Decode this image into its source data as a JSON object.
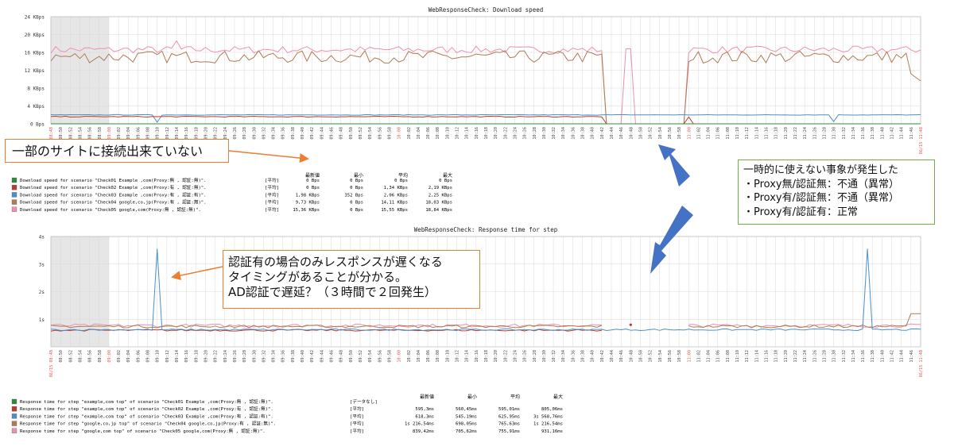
{
  "chart_data": [
    {
      "type": "line",
      "title": "WebResponseCheck: Download speed",
      "y_tick_labels": [
        "0 Bps",
        "4 KBps",
        "8 KBps",
        "12 KBps",
        "16 KBps",
        "20 KBps",
        "24 KBps"
      ],
      "ylim": [
        0,
        24
      ],
      "unit": "KBps",
      "time_range": [
        "08:48",
        "11:48"
      ],
      "gray_span": [
        "08:48",
        "09:00"
      ],
      "series": [
        {
          "name": "Download speed for scenario \"Check01 Example ,com(Proxy:無 , 認証:無)\".",
          "color": "#2e8b3e",
          "stats": {
            "agg": "[平均]",
            "last": "0 Bps",
            "min": "0 Bps",
            "avg": "0 Bps",
            "max": "0 Bps"
          }
        },
        {
          "name": "Download speed for scenario \"Check02 Example ,com(Proxy:有 , 認証:無)\".",
          "color": "#c0392b",
          "stats": {
            "agg": "[平均]",
            "last": "0 Bps",
            "min": "0 Bps",
            "avg": "1,34 KBps",
            "max": "2,19 KBps"
          }
        },
        {
          "name": "Download speed for scenario \"Check03 Example ,com(Proxy:有 , 認証:有)\".",
          "color": "#4a90c8",
          "stats": {
            "agg": "[平均]",
            "last": "1,98 KBps",
            "min": "352 Bps",
            "avg": "2,06 KBps",
            "max": "2,25 KBps"
          }
        },
        {
          "name": "Download speed for scenario \"Check04 google,co,jp(Proxy:有 , 認証:無)\".",
          "color": "#b07a55",
          "stats": {
            "agg": "[平均]",
            "last": "9,73 KBps",
            "min": "0 Bps",
            "avg": "14,11 KBps",
            "max": "18,03 KBps"
          }
        },
        {
          "name": "Download speed for scenario \"Check05 google,com(Proxy:無 , 認証:無)\".",
          "color": "#ee8fb0",
          "stats": {
            "agg": "[平均]",
            "last": "15,36 KBps",
            "min": "0 Bps",
            "avg": "15,55 KBps",
            "max": "18,84 KBps"
          }
        }
      ]
    },
    {
      "type": "line",
      "title": "WebResponseCheck: Response time for step",
      "y_tick_labels": [
        "1s",
        "2s",
        "3s",
        "4s"
      ],
      "ylim": [
        0,
        4
      ],
      "unit": "s",
      "time_range": [
        "08:48",
        "11:48"
      ],
      "gray_span": [
        "08:48",
        "09:00"
      ],
      "series": [
        {
          "name": "Response time for step \"example,com top\" of scenario \"Check01 Example ,com(Proxy:無 , 認証:無)\".",
          "color": "#2e8b3e",
          "stats": {
            "agg": "[データなし]",
            "last": "",
            "min": "",
            "avg": "",
            "max": ""
          }
        },
        {
          "name": "Response time for step \"example,com top\" of scenario \"Check02 Example ,com(Proxy:有 , 認証:無)\".",
          "color": "#c0392b",
          "stats": {
            "agg": "[平均]",
            "last": "595,3ms",
            "min": "560,45ms",
            "avg": "595,01ms",
            "max": "805,06ms"
          }
        },
        {
          "name": "Response time for step \"example,com top\" of scenario \"Check03 Example ,com(Proxy:有 , 認証:有)\".",
          "color": "#4a90c8",
          "stats": {
            "agg": "[平均]",
            "last": "618,3ms",
            "min": "545,19ms",
            "avg": "625,95ms",
            "max": "3s 568,76ms"
          }
        },
        {
          "name": "Response time for step \"google,co,jp top\" of scenario \"Check04 google,co,jp(Proxy:有 , 認証:無)\".",
          "color": "#b07a55",
          "stats": {
            "agg": "[平均]",
            "last": "1s 216,54ms",
            "min": "698,05ms",
            "avg": "765,63ms",
            "max": "1s 216,54ms"
          }
        },
        {
          "name": "Response time for step \"google,com top\" of scenario \"Check05 google,com(Proxy:無 , 認証:無)\".",
          "color": "#ee8fb0",
          "stats": {
            "agg": "[平均]",
            "last": "839,42ms",
            "min": "705,62ms",
            "avg": "755,91ms",
            "max": "931,16ms"
          }
        }
      ]
    }
  ],
  "legend_headers": {
    "last": "最新値",
    "min": "最小",
    "avg": "平均",
    "max": "最大"
  },
  "axis_date_label": "06/15",
  "callouts": {
    "top_left": "一部のサイトに接続出来ていない",
    "middle": [
      "認証有の場合のみレスポンスが遅くなる",
      "タイミングがあることが分かる。",
      "AD認証で遅延？（３時間で２回発生）"
    ],
    "right": [
      "一時的に使えない事象が発生した",
      "・Proxy無/認証無：不通（異常）",
      "・Proxy有/認証無：不通（異常）",
      "・Proxy有/認証有：正常"
    ]
  },
  "colors": {
    "arrow_orange": "#ed7d31",
    "arrow_blue": "#4472c4",
    "gray_region": "#e6e6e6",
    "grid": "#d9d9d9",
    "hour_label": "#e05555"
  }
}
